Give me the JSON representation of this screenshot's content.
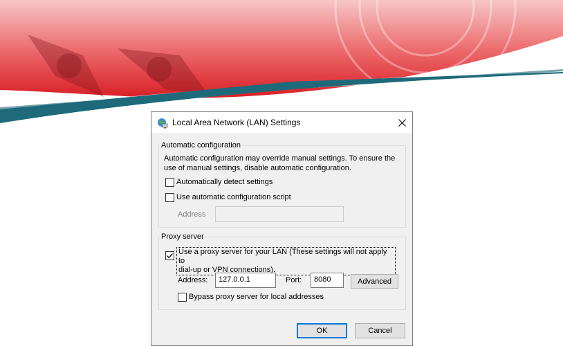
{
  "colors": {
    "banner_red": "#e0242b",
    "banner_teal": "#1f6a7a",
    "dialog_bg": "#f0f0f0",
    "accent_blue": "#0078d7"
  },
  "dialog": {
    "title": "Local Area Network (LAN) Settings",
    "icon": "network-globe-icon",
    "close_icon": "close-icon"
  },
  "automatic_configuration": {
    "legend": "Automatic configuration",
    "description": "Automatic configuration may override manual settings.  To ensure the\nuse of manual settings, disable automatic configuration.",
    "auto_detect": {
      "label": "Automatically detect settings",
      "checked": false
    },
    "use_script": {
      "label": "Use automatic configuration script",
      "checked": false
    },
    "address_label": "Address",
    "address_value": ""
  },
  "proxy_server": {
    "legend": "Proxy server",
    "use_proxy": {
      "label": "Use a proxy server for your LAN (These settings will not apply to\ndial-up or VPN connections).",
      "checked": true
    },
    "address_label": "Address:",
    "address_value": "127.0.0.1",
    "port_label": "Port:",
    "port_value": "8080",
    "advanced_label": "Advanced",
    "bypass": {
      "label": "Bypass proxy server for local addresses",
      "checked": false
    }
  },
  "buttons": {
    "ok": "OK",
    "cancel": "Cancel"
  }
}
